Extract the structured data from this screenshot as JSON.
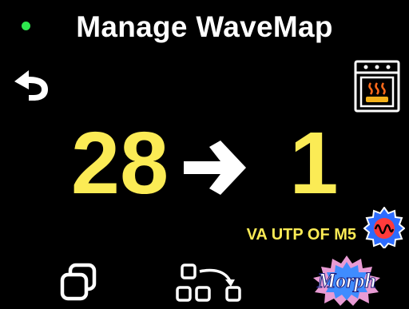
{
  "header": {
    "title": "Manage WaveMap",
    "status_dot_color": "#2ee84e",
    "back_icon": "undo-arrow-icon",
    "oven_icon": "oven-icon"
  },
  "main": {
    "from_slot": "28",
    "to_slot": "1",
    "arrow_icon": "right-arrow-icon",
    "accent_color": "#fbeb55"
  },
  "status": {
    "text": "VA UTP OF M5",
    "wave_icon": "waveform-gear-icon"
  },
  "toolbar": {
    "copy_icon": "copy-icon",
    "move_icon": "move-slots-icon",
    "morph_label": "Morph"
  }
}
